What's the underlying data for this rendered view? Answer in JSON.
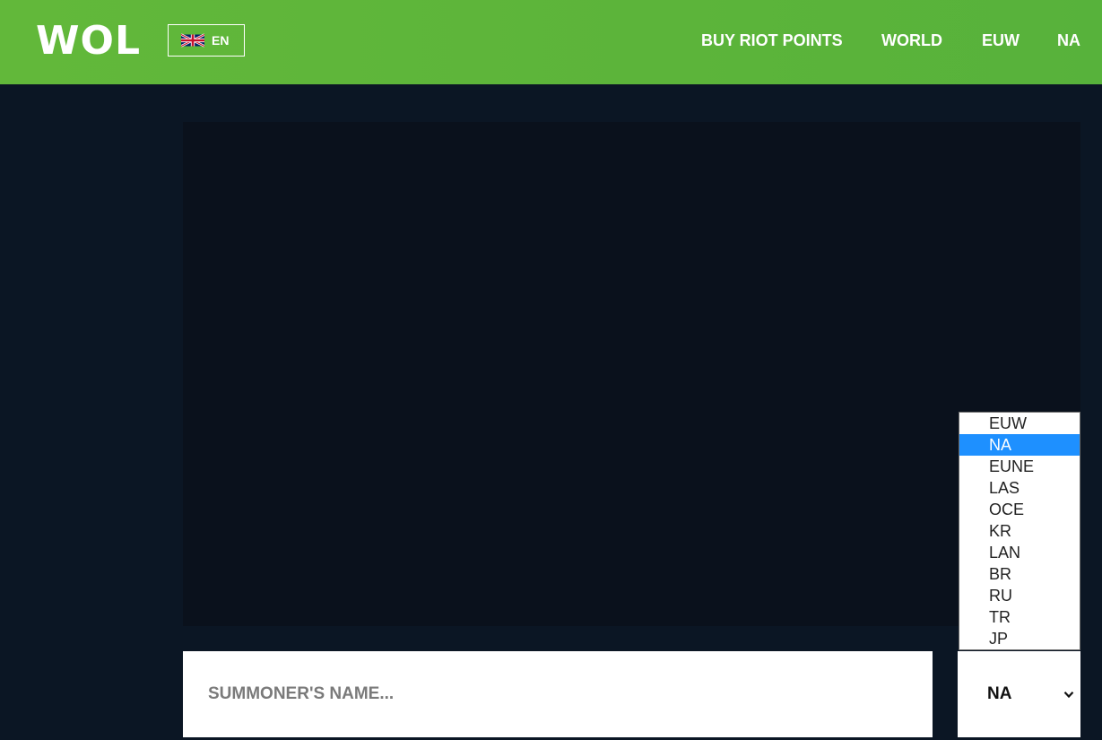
{
  "header": {
    "logo": "WOL",
    "language": {
      "label": "EN",
      "flag": "uk-flag-icon"
    },
    "nav": [
      {
        "label": "BUY RIOT POINTS"
      },
      {
        "label": "WORLD"
      },
      {
        "label": "EUW"
      },
      {
        "label": "NA"
      }
    ]
  },
  "search": {
    "placeholder": "SUMMONER'S NAME...",
    "value": ""
  },
  "region": {
    "selected": "NA",
    "chevron": "chevron-down-icon",
    "options": [
      "EUW",
      "NA",
      "EUNE",
      "LAS",
      "OCE",
      "KR",
      "LAN",
      "BR",
      "RU",
      "TR",
      "JP"
    ],
    "highlighted": "NA"
  },
  "colors": {
    "header": "#5cb43a",
    "background": "#0b1624",
    "video_area": "#0a111c",
    "option_highlight": "#1e90ff"
  }
}
